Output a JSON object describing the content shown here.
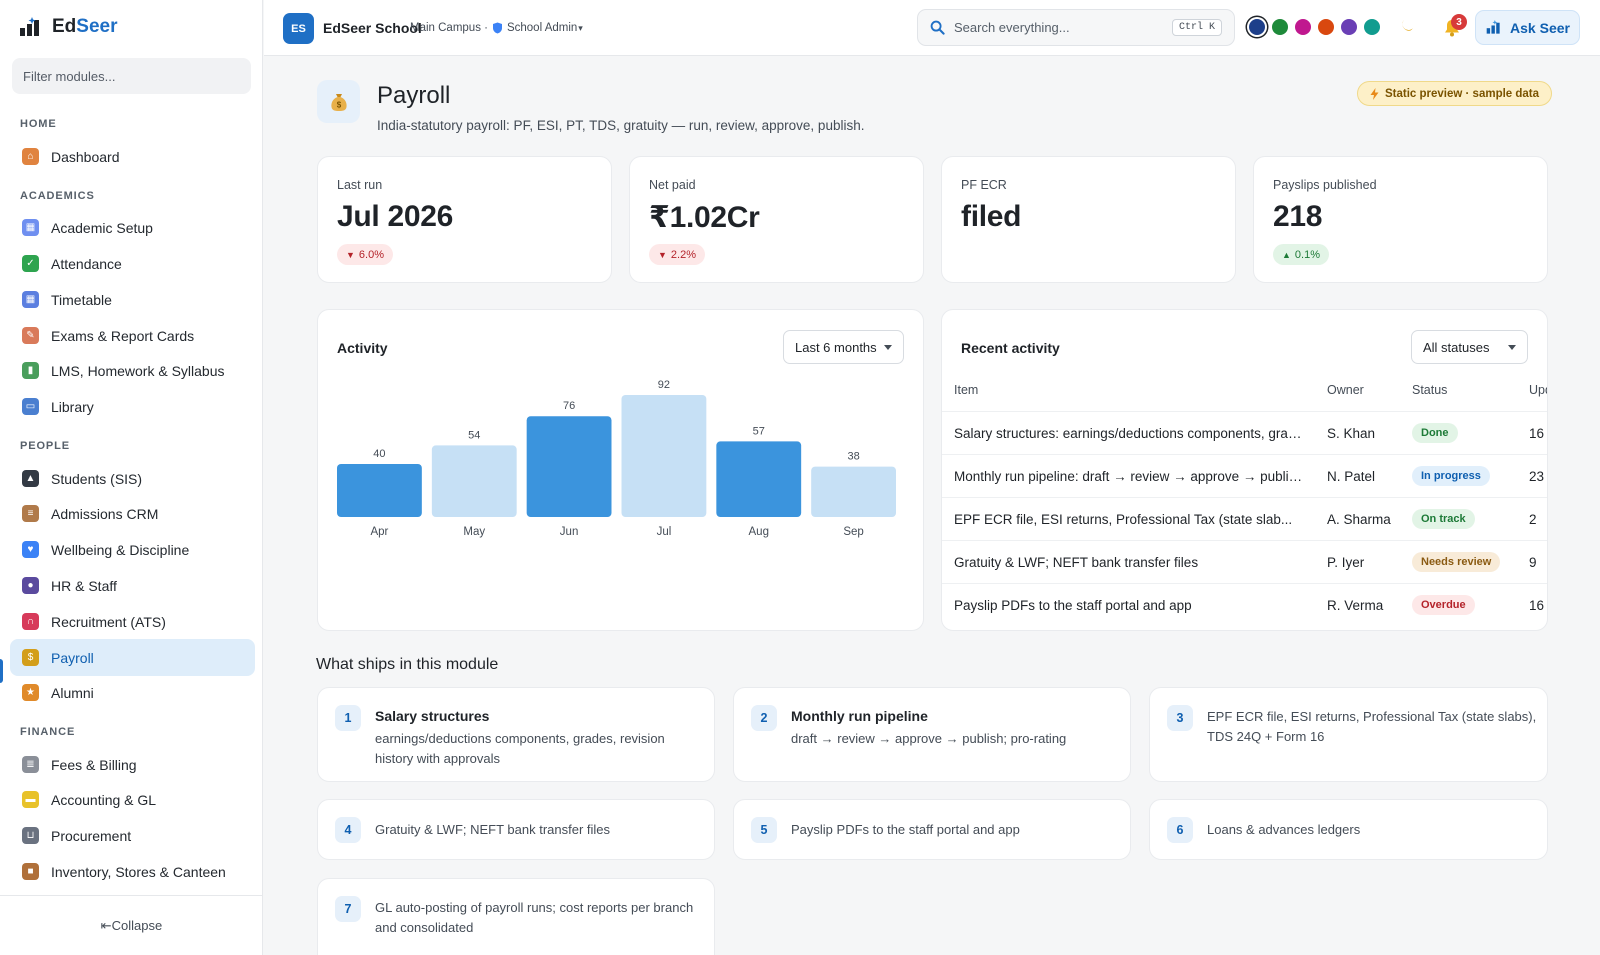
{
  "brand": {
    "name_part1": "Ed",
    "name_part2": "Seer"
  },
  "sidebar": {
    "filter_placeholder": "Filter modules...",
    "sections": [
      {
        "label": "HOME",
        "items": [
          {
            "label": "Dashboard",
            "icon": "house-icon",
            "color": "#e0833f"
          }
        ]
      },
      {
        "label": "ACADEMICS",
        "items": [
          {
            "label": "Academic Setup",
            "icon": "calendar-icon",
            "color": "#6f8ff0"
          },
          {
            "label": "Attendance",
            "icon": "check-box-icon",
            "color": "#2ea44f"
          },
          {
            "label": "Timetable",
            "icon": "calendar-grid-icon",
            "color": "#5b7fe0"
          },
          {
            "label": "Exams & Report Cards",
            "icon": "memo-icon",
            "color": "#d97a5a"
          },
          {
            "label": "LMS, Homework & Syllabus",
            "icon": "books-icon",
            "color": "#4a9e5c"
          },
          {
            "label": "Library",
            "icon": "open-book-icon",
            "color": "#4a7fd0"
          }
        ]
      },
      {
        "label": "PEOPLE",
        "items": [
          {
            "label": "Students (SIS)",
            "icon": "graduation-cap-icon",
            "color": "#333a44"
          },
          {
            "label": "Admissions CRM",
            "icon": "clipboard-icon",
            "color": "#b07a4a"
          },
          {
            "label": "Wellbeing & Discipline",
            "icon": "blue-heart-icon",
            "color": "#3b82f6"
          },
          {
            "label": "HR & Staff",
            "icon": "people-icon",
            "color": "#5a4a9e"
          },
          {
            "label": "Recruitment (ATS)",
            "icon": "magnet-icon",
            "color": "#d73a5a"
          },
          {
            "label": "Payroll",
            "icon": "money-bag-icon",
            "color": "#d39e1a",
            "active": true
          },
          {
            "label": "Alumni",
            "icon": "medal-icon",
            "color": "#e08a2a"
          }
        ]
      },
      {
        "label": "FINANCE",
        "items": [
          {
            "label": "Fees & Billing",
            "icon": "receipt-icon",
            "color": "#8a8f98"
          },
          {
            "label": "Accounting & GL",
            "icon": "ledger-icon",
            "color": "#e8c22a"
          },
          {
            "label": "Procurement",
            "icon": "cart-icon",
            "color": "#6a7280"
          },
          {
            "label": "Inventory, Stores & Canteen",
            "icon": "package-icon",
            "color": "#b0703a"
          }
        ]
      }
    ],
    "collapse_label": "⇤Collapse"
  },
  "topbar": {
    "logo_initials": "ES",
    "school_name": "EdSeer School",
    "campus": "Main Campus ·",
    "role": "School Admin",
    "role_caret": "▾",
    "search_placeholder": "Search everything...",
    "search_shortcut": "Ctrl K",
    "theme_swatches": [
      "#1d3f8a",
      "#1e8a3a",
      "#c0188f",
      "#d9480f",
      "#6a3fb5",
      "#119c8f"
    ],
    "notification_count": "3",
    "ask_label": "Ask Seer"
  },
  "page": {
    "icon": "money-bag-icon",
    "title": "Payroll",
    "subtitle": "India-statutory payroll: PF, ESI, PT, TDS, gratuity — run, review, approve, publish.",
    "preview_badge": "Static preview · sample data"
  },
  "kpis": [
    {
      "label": "Last run",
      "value": "Jul 2026",
      "delta": "6.0%",
      "direction": "down"
    },
    {
      "label": "Net paid",
      "value": "₹1.02Cr",
      "delta": "2.2%",
      "direction": "down"
    },
    {
      "label": "PF ECR",
      "value": "filed",
      "delta": "",
      "direction": ""
    },
    {
      "label": "Payslips published",
      "value": "218",
      "delta": "0.1%",
      "direction": "up"
    }
  ],
  "activity": {
    "title": "Activity",
    "range_selected": "Last 6 months"
  },
  "chart_data": {
    "type": "bar",
    "title": "Activity",
    "categories": [
      "Apr",
      "May",
      "Jun",
      "Jul",
      "Aug",
      "Sep"
    ],
    "values": [
      40,
      54,
      76,
      92,
      57,
      38
    ],
    "ylim": [
      0,
      100
    ],
    "colors": [
      "#3b94dd",
      "#c6e0f5",
      "#3b94dd",
      "#c6e0f5",
      "#3b94dd",
      "#c6e0f5"
    ],
    "grid": false,
    "legend": "none"
  },
  "recent": {
    "title": "Recent activity",
    "filter_selected": "All statuses",
    "columns": [
      "Item",
      "Owner",
      "Status",
      "Upd"
    ],
    "rows": [
      {
        "item": "Salary structures: earnings/deductions components, grad...",
        "owner": "S. Khan",
        "status": "Done",
        "status_bg": "#e2f4e6",
        "status_fg": "#1d7a37",
        "updated": "16"
      },
      {
        "item": "Monthly run pipeline: draft → review → approve → publis...",
        "owner": "N. Patel",
        "status": "In progress",
        "status_bg": "#e1effb",
        "status_fg": "#0f5fb0",
        "updated": "23"
      },
      {
        "item": "EPF ECR file, ESI returns, Professional Tax (state slab...",
        "owner": "A. Sharma",
        "status": "On track",
        "status_bg": "#e2f4e6",
        "status_fg": "#1d7a37",
        "updated": "2"
      },
      {
        "item": "Gratuity & LWF; NEFT bank transfer files",
        "owner": "P. Iyer",
        "status": "Needs review",
        "status_bg": "#f8ebd8",
        "status_fg": "#8a5a12",
        "updated": "9"
      },
      {
        "item": "Payslip PDFs to the staff portal and app",
        "owner": "R. Verma",
        "status": "Overdue",
        "status_bg": "#fde8e8",
        "status_fg": "#b4232a",
        "updated": "16"
      }
    ]
  },
  "features": {
    "heading": "What ships in this module",
    "items": [
      {
        "num": "1",
        "title": "Salary structures",
        "desc": "earnings/deductions components, grades, revision history with approvals"
      },
      {
        "num": "2",
        "title": "Monthly run pipeline",
        "desc": "draft → review → approve → publish; pro-rating"
      },
      {
        "num": "3",
        "title": "",
        "desc": "EPF ECR file, ESI returns, Professional Tax (state slabs), TDS 24Q + Form 16"
      },
      {
        "num": "4",
        "title": "",
        "desc": "Gratuity & LWF; NEFT bank transfer files"
      },
      {
        "num": "5",
        "title": "",
        "desc": "Payslip PDFs to the staff portal and app"
      },
      {
        "num": "6",
        "title": "",
        "desc": "Loans & advances ledgers"
      },
      {
        "num": "7",
        "title": "",
        "desc": "GL auto-posting of payroll runs; cost reports per branch and consolidated"
      }
    ]
  }
}
